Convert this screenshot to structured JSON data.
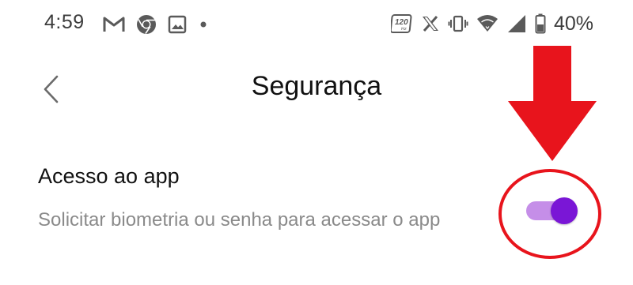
{
  "status_bar": {
    "time": "4:59",
    "left_icons": [
      "gmail-icon",
      "chrome-icon",
      "image-icon",
      "dot-icon"
    ],
    "right_icons": [
      "120hz-icon",
      "x-icon",
      "vibrate-icon",
      "wifi-icon",
      "signal-icon",
      "battery-icon"
    ],
    "refresh_rate_label": "120",
    "refresh_rate_unit": "Hz",
    "battery": "40%"
  },
  "header": {
    "title": "Segurança",
    "back_icon": "chevron-left-icon"
  },
  "setting": {
    "title": "Acesso ao app",
    "description": "Solicitar biometria ou senha para acessar o app",
    "toggle_on": true
  },
  "colors": {
    "toggle_track": "#c58ee8",
    "toggle_thumb": "#7a16d6",
    "annotation": "#e8141c"
  }
}
